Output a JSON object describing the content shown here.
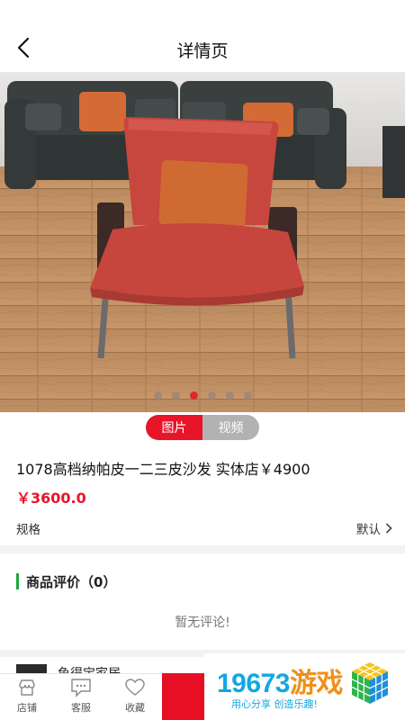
{
  "header": {
    "title": "详情页",
    "back_icon": "chevron-left-icon"
  },
  "gallery": {
    "slide_count": 6,
    "active_slide": 3
  },
  "media_toggle": {
    "image_label": "图片",
    "video_label": "视频"
  },
  "product": {
    "title": "1078高档纳帕皮一二三皮沙发 实体店￥4900",
    "price": "￥3600.0",
    "spec_label": "规格",
    "spec_value": "默认"
  },
  "reviews": {
    "title": "商品评价（0）",
    "empty_text": "暂无评论!"
  },
  "store": {
    "name": "鱼得宝家居"
  },
  "bottom_bar": {
    "tabs": [
      {
        "label": "店铺",
        "icon": "store-icon"
      },
      {
        "label": "客服",
        "icon": "chat-icon"
      },
      {
        "label": "收藏",
        "icon": "heart-icon"
      }
    ]
  },
  "banner": {
    "number": "19673",
    "game_text": "游戏",
    "slogan": "用心分享  创造乐趣!"
  },
  "colors": {
    "accent": "#e8152a",
    "review_bar": "#1ea83c",
    "banner_blue": "#12a8e0",
    "banner_orange": "#f0901a"
  }
}
